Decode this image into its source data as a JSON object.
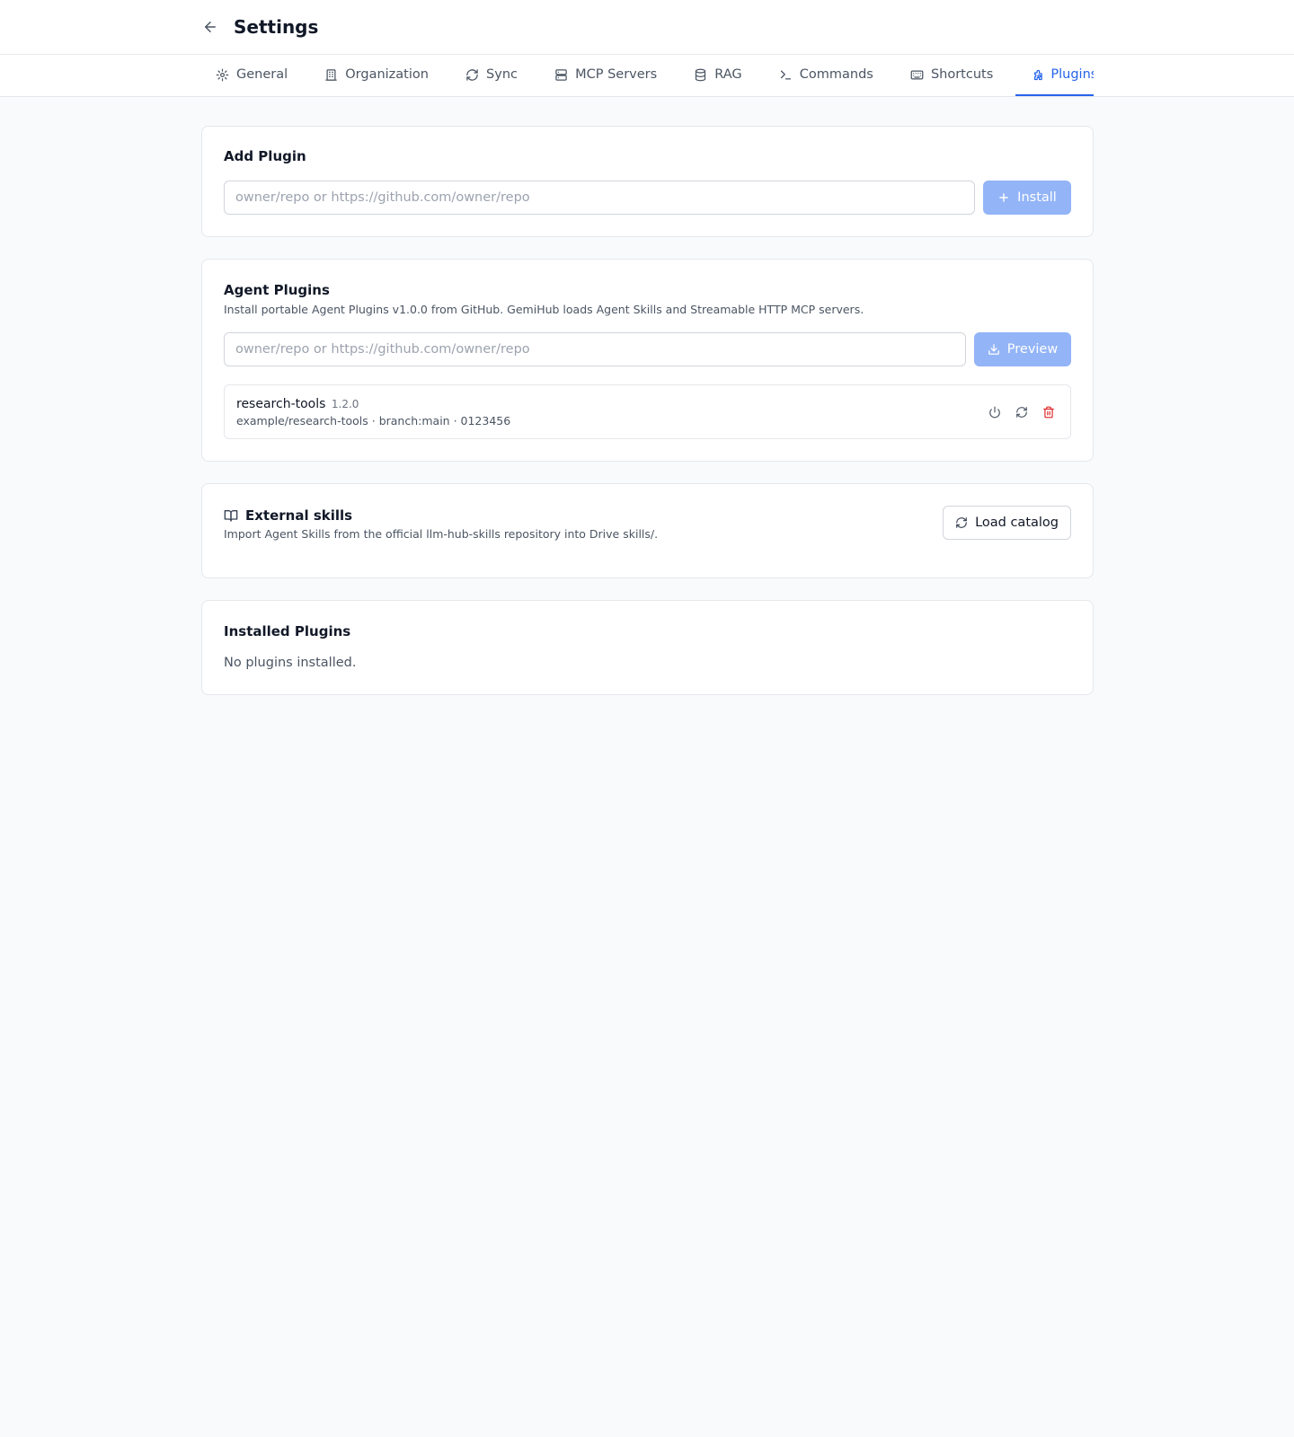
{
  "header": {
    "title": "Settings"
  },
  "tabs": [
    {
      "label": "General",
      "icon": "gear-icon",
      "active": false
    },
    {
      "label": "Organization",
      "icon": "building-icon",
      "active": false
    },
    {
      "label": "Sync",
      "icon": "refresh-icon",
      "active": false
    },
    {
      "label": "MCP Servers",
      "icon": "server-icon",
      "active": false
    },
    {
      "label": "RAG",
      "icon": "database-icon",
      "active": false
    },
    {
      "label": "Commands",
      "icon": "terminal-icon",
      "active": false
    },
    {
      "label": "Shortcuts",
      "icon": "keyboard-icon",
      "active": false
    },
    {
      "label": "Plugins",
      "icon": "puzzle-icon",
      "active": true
    }
  ],
  "add_plugin": {
    "title": "Add Plugin",
    "input_placeholder": "owner/repo or https://github.com/owner/repo",
    "install_label": "Install"
  },
  "agent_plugins": {
    "title": "Agent Plugins",
    "description": "Install portable Agent Plugins v1.0.0 from GitHub. GemiHub loads Agent Skills and Streamable HTTP MCP servers.",
    "input_placeholder": "owner/repo or https://github.com/owner/repo",
    "preview_label": "Preview",
    "plugins": [
      {
        "name": "research-tools",
        "version": "1.2.0",
        "meta": "example/research-tools · branch:main · 0123456"
      }
    ]
  },
  "external_skills": {
    "title": "External skills",
    "description": "Import Agent Skills from the official llm-hub-skills repository into Drive skills/.",
    "load_label": "Load catalog"
  },
  "installed_plugins": {
    "title": "Installed Plugins",
    "empty_text": "No plugins installed."
  },
  "colors": {
    "accent": "#2563eb",
    "primary_button_disabled": "#93b4f7",
    "danger": "#dc2626",
    "background": "#f9fafb",
    "border": "#e5e7eb"
  }
}
